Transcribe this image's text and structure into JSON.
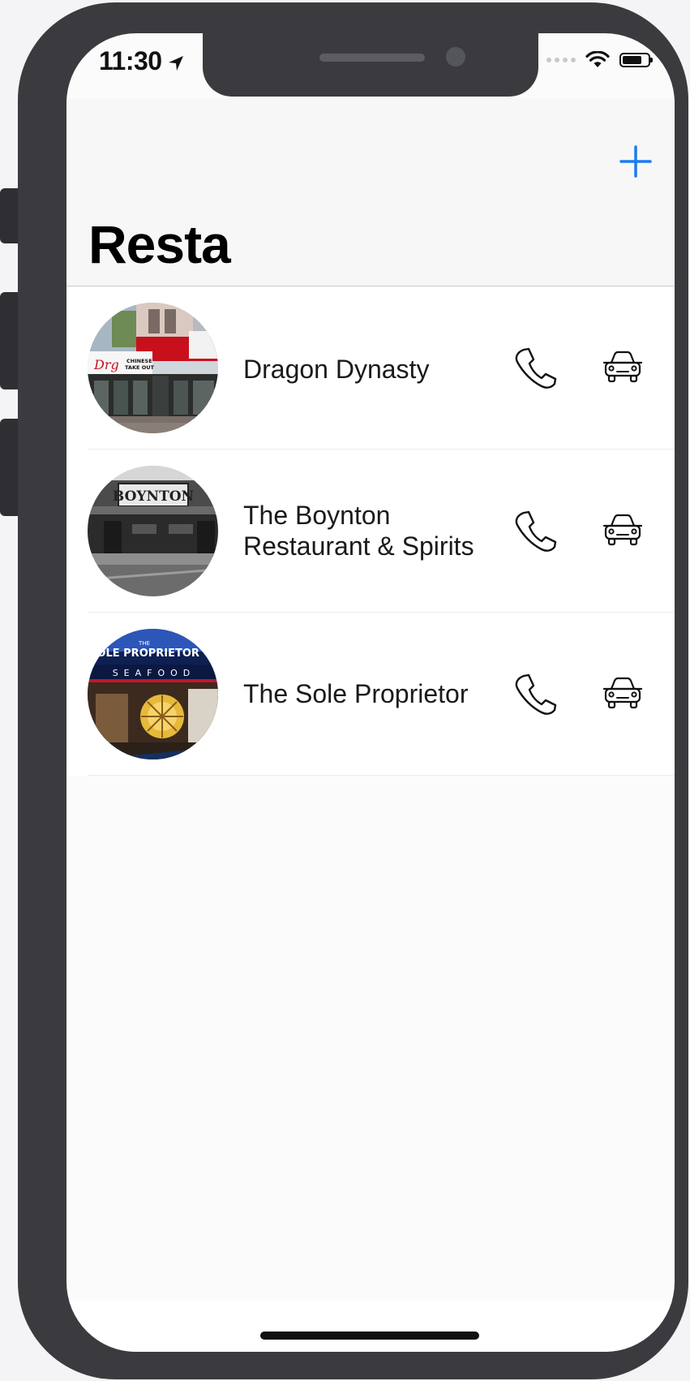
{
  "status_bar": {
    "time": "11:30",
    "icons": [
      "location-arrow-icon",
      "signal-dots-icon",
      "wifi-icon",
      "battery-icon"
    ],
    "battery_level": 0.75
  },
  "nav": {
    "title": "Resta",
    "add_icon": "plus-icon",
    "accent_color": "#1a7cf2"
  },
  "restaurants": [
    {
      "name": "Dragon Dynasty",
      "call_icon": "phone-icon",
      "directions_icon": "car-icon"
    },
    {
      "name": "The Boynton Restaurant & Spirits",
      "call_icon": "phone-icon",
      "directions_icon": "car-icon"
    },
    {
      "name": "The Sole Proprietor",
      "call_icon": "phone-icon",
      "directions_icon": "car-icon"
    }
  ],
  "photo_signage": {
    "dragon": [
      "CHINESE",
      "TAKE OUT"
    ],
    "boynton": "BOYNTON",
    "sole": [
      "THE",
      "SOLE PROPRIETOR",
      "SEAFOOD"
    ]
  }
}
